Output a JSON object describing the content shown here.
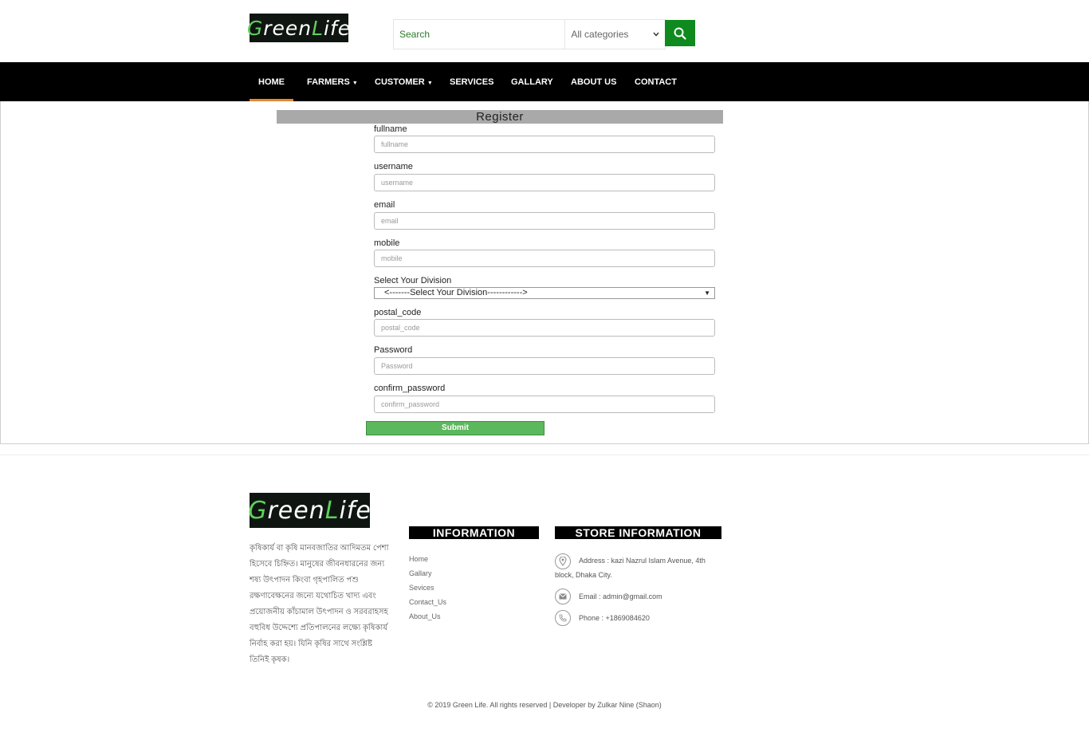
{
  "header": {
    "logo_text_a": "G",
    "logo_text_b": "reen ",
    "logo_text_c": "L",
    "logo_text_d": "ife",
    "search_placeholder": "Search",
    "category_value": "All categories",
    "accent": "#0e8a1e"
  },
  "nav": {
    "items": [
      {
        "label": "HOME"
      },
      {
        "label": "FARMERS"
      },
      {
        "label": "CUSTOMER"
      },
      {
        "label": "SERVICES"
      },
      {
        "label": "GALLARY"
      },
      {
        "label": "ABOUT US"
      },
      {
        "label": "CONTACT"
      }
    ],
    "active_color": "#e28a2e"
  },
  "form": {
    "title": "Register",
    "fullname_label": "fullname",
    "fullname_placeholder": "fullname",
    "username_label": "username",
    "username_placeholder": "username",
    "email_label": "email",
    "email_placeholder": "email",
    "mobile_label": "mobile",
    "mobile_placeholder": "mobile",
    "division_label": "Select Your Division",
    "division_value": "<-------Select Your Division------------>",
    "postal_label": "postal_code",
    "postal_placeholder": "postal_code",
    "password_label": "Password",
    "password_placeholder": "Password",
    "confirm_label": "confirm_password",
    "confirm_placeholder": "confirm_password",
    "submit_label": "Submit",
    "submit_color": "#5cb85c"
  },
  "footer": {
    "about_text": "কৃষিকার্য বা কৃষি মানবজাতির আদিমতম পেশা হিসেবে চিহ্নিত। মানুষের জীবনধারনের জন্য শষ্য উৎপাদন কিংবা গৃহপালিত পশু রক্ষণাবেক্ষনের জন্যে যথোচিত খাদ্য এবং প্রয়োজনীয় কাঁচামাল উৎপাদন ও সরবরাহসহ বহুবিধ উদ্দেশ্যে প্রতিপালনের লক্ষ্যে কৃষিকার্য নির্বাহ করা হয়। যিনি কৃষির সাথে সংশ্লিষ্ট তিনিই কৃষক।",
    "information_heading": "INFORMATION",
    "links": [
      "Home",
      "Gallary",
      "Sevices",
      "Contact_Us",
      "About_Us"
    ],
    "store_heading": "STORE INFORMATION",
    "address": "Address : kazi Nazrul Islam Avenue, 4th block, Dhaka City.",
    "email": "Email : admin@gmail.com",
    "phone": "Phone : +1869084620",
    "copyright": "© 2019 Green Life. All rights reserved | Developer by Zulkar Nine (Shaon)"
  }
}
